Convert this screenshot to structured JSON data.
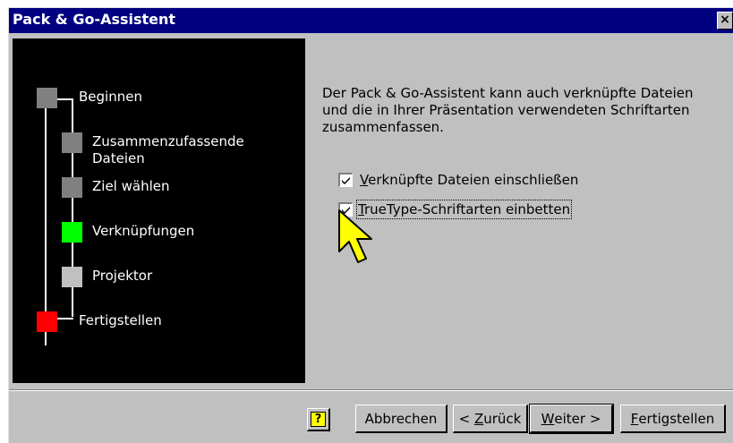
{
  "window": {
    "title": "Pack & Go-Assistent",
    "close_glyph": "×"
  },
  "steps": [
    {
      "label": "Beginnen",
      "color": "#808080"
    },
    {
      "label": "Zusammenzufassende Dateien",
      "color": "#808080"
    },
    {
      "label": "Ziel wählen",
      "color": "#808080"
    },
    {
      "label": "Verknüpfungen",
      "color": "#00ff00"
    },
    {
      "label": "Projektor",
      "color": "#c0c0c0"
    },
    {
      "label": "Fertigstellen",
      "color": "#ff0000"
    }
  ],
  "content": {
    "description": "Der Pack & Go-Assistent kann auch verknüpfte Dateien und die in Ihrer Präsentation verwendeten Schriftarten zusammenfassen.",
    "checkboxes": [
      {
        "mnemonic": "V",
        "rest": "erknüpfte Dateien einschließen",
        "checked": true
      },
      {
        "mnemonic": "T",
        "rest": "rueType-Schriftarten einbetten",
        "checked": true,
        "focused": true
      }
    ]
  },
  "buttons": {
    "help_glyph": "?",
    "cancel": "Abbrechen",
    "back_prefix": "< ",
    "back_mnemonic": "Z",
    "back_rest": "urück",
    "next_mnemonic": "W",
    "next_rest": "eiter >",
    "finish_mnemonic": "F",
    "finish_rest": "ertigstellen"
  },
  "icons": {
    "cursor": "arrow-cursor-icon",
    "help": "help-icon",
    "close": "close-icon"
  }
}
